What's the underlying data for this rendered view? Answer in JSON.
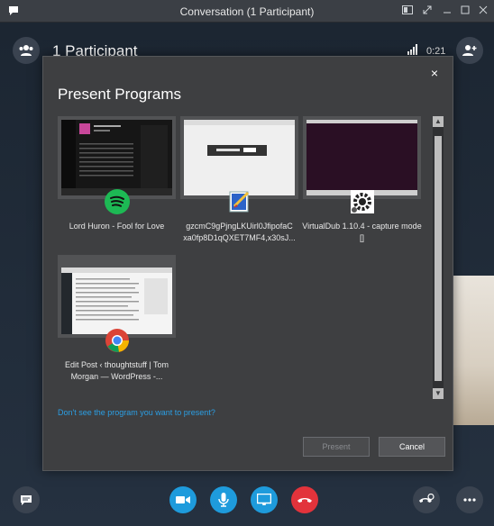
{
  "window": {
    "title": "Conversation (1 Participant)"
  },
  "call": {
    "participants_label": "1 Participant",
    "timer": "0:21"
  },
  "dialog": {
    "close": "×",
    "heading": "Present Programs",
    "programs": [
      {
        "label": "Lord Huron - Fool for Love",
        "icon": "spotify-icon"
      },
      {
        "label": "gzcmC9gPjngLKUirl0JfipofaC xa0fp8D1qQXET7MF4,x30sJ...",
        "icon": "paint-icon"
      },
      {
        "label": "VirtualDub 1.10.4 - capture mode []",
        "icon": "virtualdub-icon"
      },
      {
        "label": "Edit Post ‹ thoughtstuff | Tom Morgan — WordPress -...",
        "icon": "chrome-icon"
      }
    ],
    "help_link": "Don't see the program you want to present?",
    "present_button": "Present",
    "cancel_button": "Cancel"
  },
  "colors": {
    "accent": "#1e9bdc",
    "end_call": "#e2333b",
    "link": "#2b9ee3",
    "dialog_bg": "#3e3f41"
  }
}
